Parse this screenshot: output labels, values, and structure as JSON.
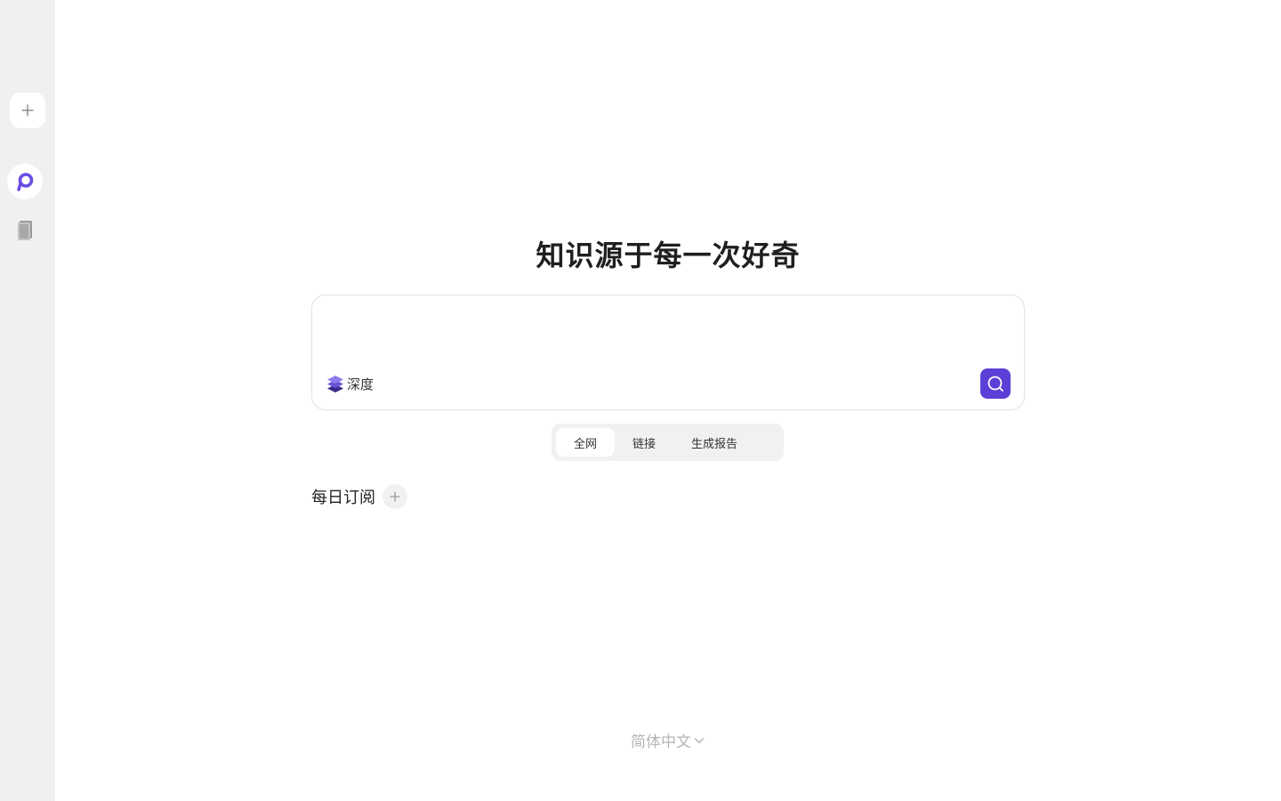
{
  "sidebar": {
    "new_chat_icon": "plus-icon",
    "logo_icon": "logo-icon",
    "library_icon": "book-icon",
    "accent_color": "#6b4de6"
  },
  "hero": {
    "title": "知识源于每一次好奇"
  },
  "search": {
    "value": "",
    "placeholder": "",
    "depth_label": "深度",
    "depth_icon": "layers-icon",
    "submit_icon": "search-icon",
    "submit_color": "#5b3fd6"
  },
  "mode_tabs": {
    "items": [
      {
        "label": "全网",
        "active": true
      },
      {
        "label": "链接",
        "active": false
      },
      {
        "label": "生成报告",
        "active": false
      }
    ]
  },
  "daily": {
    "title": "每日订阅",
    "add_icon": "plus-icon"
  },
  "footer": {
    "language": "简体中文",
    "language_icon": "chevron-down-icon"
  }
}
